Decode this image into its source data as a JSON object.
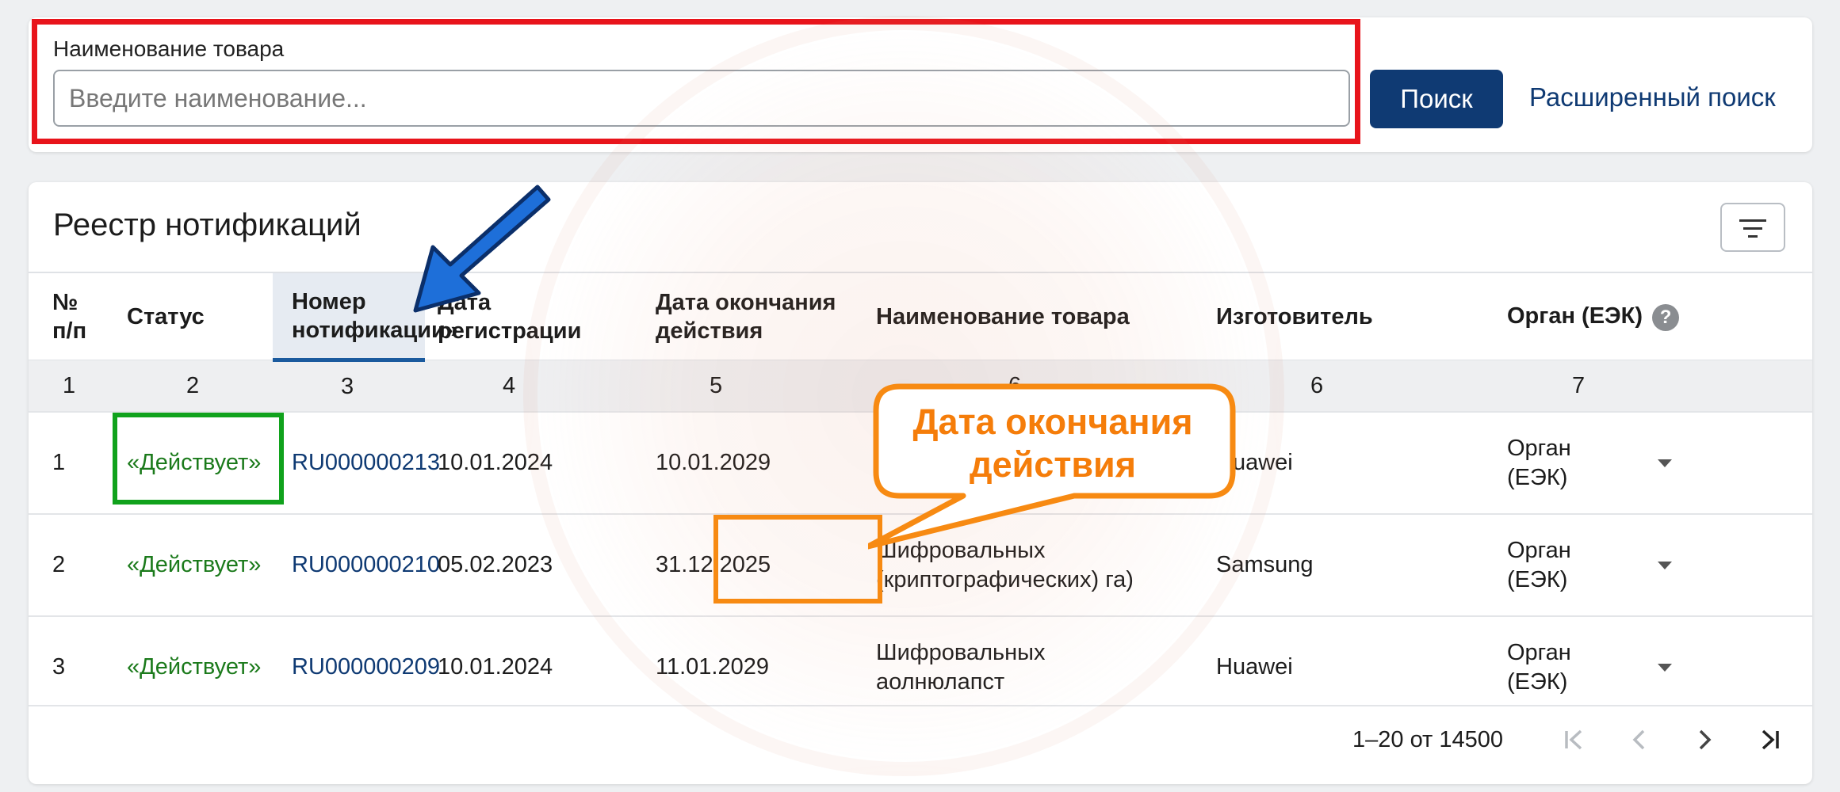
{
  "search": {
    "label": "Наименование товара",
    "placeholder": "Введите наименование...",
    "value": "",
    "button": "Поиск",
    "advanced": "Расширенный поиск"
  },
  "registry": {
    "title": "Реестр нотификаций",
    "columns": [
      {
        "line1": "№",
        "line2": "п/п"
      },
      {
        "line1": "Статус",
        "line2": ""
      },
      {
        "line1": "Номер",
        "line2": "нотификации»"
      },
      {
        "line1": "Дата",
        "line2": "регистрации"
      },
      {
        "line1": "Дата окончания",
        "line2": "действия"
      },
      {
        "line1": "Наименование товара",
        "line2": ""
      },
      {
        "line1": "Изготовитель",
        "line2": ""
      },
      {
        "line1": "Орган (ЕЭК)",
        "line2": ""
      }
    ],
    "column_numbers": [
      "1",
      "2",
      "3",
      "4",
      "5",
      "6",
      "6",
      "7"
    ],
    "rows": [
      {
        "n": "1",
        "status": "«Действует»",
        "number": "RU000000213",
        "reg_date": "10.01.2024",
        "end_date": "10.01.2029",
        "product_1": "",
        "product_2": "",
        "maker": "Huawei",
        "organ_1": "Орган",
        "organ_2": "(ЕЭК)"
      },
      {
        "n": "2",
        "status": "«Действует»",
        "number": "RU000000210",
        "reg_date": "05.02.2023",
        "end_date": "31.12.2025",
        "product_1": "Шифровальных",
        "product_2": "(криптографических) га)",
        "maker": "Samsung",
        "organ_1": "Орган",
        "organ_2": "(ЕЭК)"
      },
      {
        "n": "3",
        "status": "«Действует»",
        "number": "RU000000209",
        "reg_date": "10.01.2024",
        "end_date": "11.01.2029",
        "product_1": "Шифровальных",
        "product_2": "аолнюлапст",
        "maker": "Huawei",
        "organ_1": "Орган",
        "organ_2": "(ЕЭК)"
      }
    ],
    "pagination": "1–20 от 14500",
    "help_glyph": "?"
  },
  "annotations": {
    "callout_line1": "Дата окончания",
    "callout_line2": "действия",
    "highlight_red": "#e8141b",
    "highlight_green": "#10a21c",
    "highlight_orange": "#f78a12",
    "arrow_blue": "#1e6fd9"
  },
  "icons": [
    "filter-icon",
    "help-icon",
    "chevron-down-icon",
    "first-page-icon",
    "prev-page-icon",
    "next-page-icon",
    "last-page-icon",
    "arrow-annotation-icon"
  ]
}
